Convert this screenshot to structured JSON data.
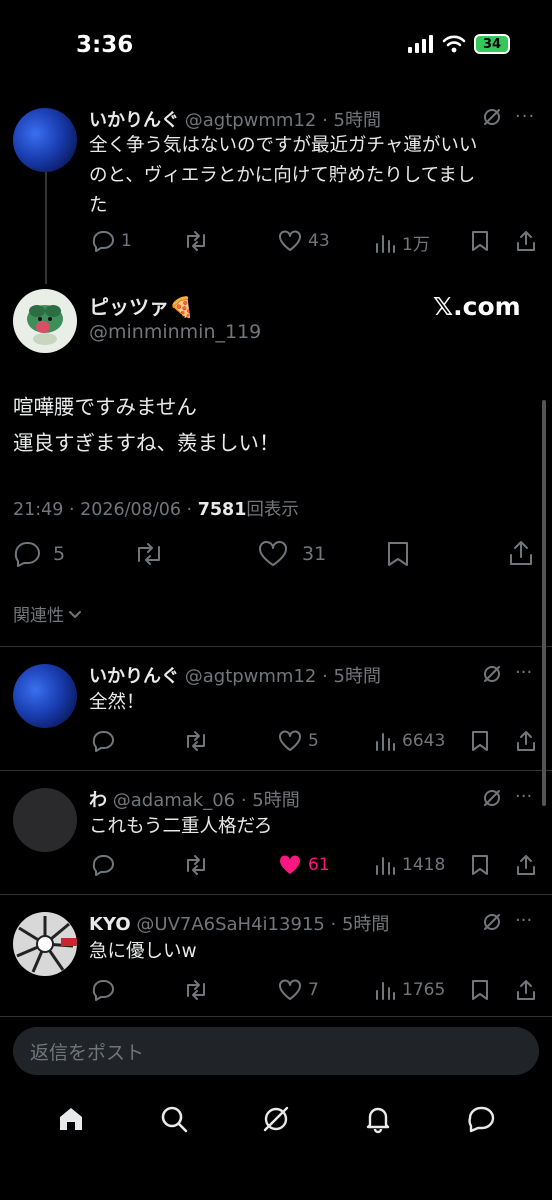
{
  "status_bar": {
    "time": "3:36",
    "battery": "34"
  },
  "parent_tweet": {
    "name": "いかりんぐ",
    "handle": "@agtpwmm12",
    "time": "5時間",
    "text_lines": [
      "全く争う気はないのですが最近ガチャ運がいい",
      "のと、ヴィエラとかに向けて貯めたりしてまし",
      "た"
    ],
    "replies": "1",
    "retweets": "",
    "likes": "43",
    "views": "1万"
  },
  "main_tweet": {
    "name": "ピッツァ🍕",
    "handle": "@minminmin_119",
    "watermark": "𝕏.com",
    "text_lines": [
      "喧嘩腰ですみません",
      "運良すぎますね、羨ましい！"
    ],
    "timestamp": "21:49 · 2026/08/06 · ",
    "views_count": "7581",
    "views_label": "回表示",
    "replies": "5",
    "retweets": "",
    "likes": "31"
  },
  "sort_label": "関連性",
  "replies": [
    {
      "name": "いかりんぐ",
      "handle": "@agtpwmm12",
      "time": "5時間",
      "text": "全然！",
      "replies": "",
      "retweets": "",
      "likes": "5",
      "liked": false,
      "views": "6643"
    },
    {
      "name": "わ",
      "handle": "@adamak_06",
      "time": "5時間",
      "text": "これもう二重人格だろ",
      "replies": "",
      "retweets": "",
      "likes": "61",
      "liked": true,
      "views": "1418"
    },
    {
      "name": "KYO",
      "handle": "@UV7A6SaH4i13915",
      "time": "5時間",
      "text": "急に優しいw",
      "replies": "",
      "retweets": "",
      "likes": "7",
      "liked": false,
      "views": "1765"
    }
  ],
  "reply_placeholder": "返信をポスト",
  "colors": {
    "background": "#000000",
    "text": "#e7e9ea",
    "muted": "#71767b",
    "like_active": "#f91880",
    "divider": "#2f3336"
  }
}
